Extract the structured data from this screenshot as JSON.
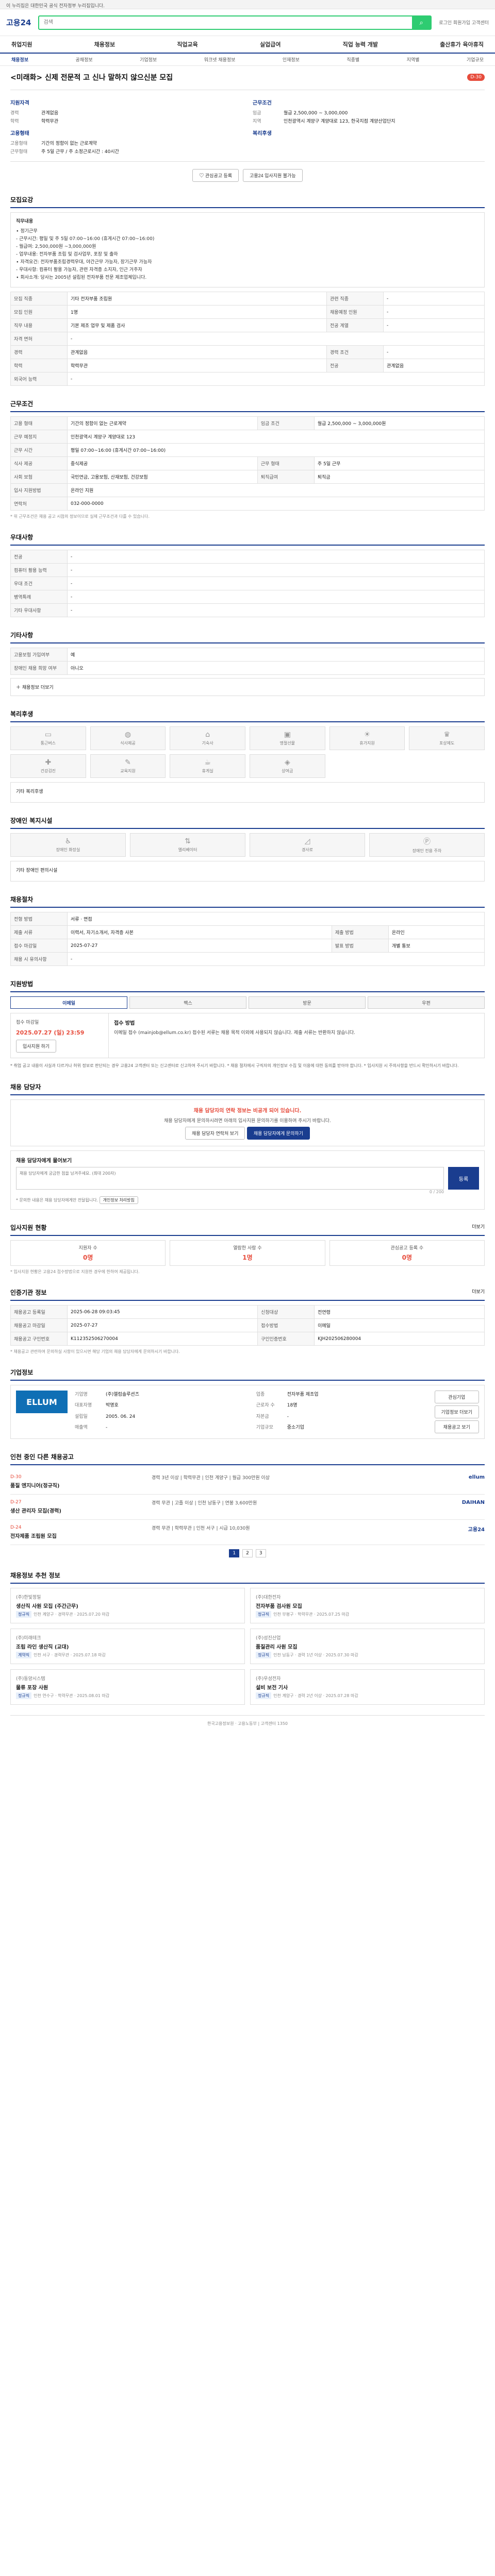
{
  "gov_banner": "이 누리집은 대한민국 공식 전자정부 누리집입니다.",
  "header": {
    "logo": "고용24",
    "search_placeholder": "검색",
    "search_icon": "search-icon",
    "right": "로그인  회원가입  고객센터"
  },
  "gnb": [
    "취업지원",
    "채용정보",
    "직업교육",
    "실업급여",
    "직업 능력 개발",
    "출산휴가 육아휴직"
  ],
  "subnav": {
    "items": [
      "채용정보",
      "공채정보",
      "기업정보",
      "워크넷 채용정보",
      "인재정보",
      "직종별",
      "지역별",
      "기업규모"
    ],
    "active": 0
  },
  "job": {
    "title": "<미래화> 신제 전문적 고 신나 말하지 않으신분 모집",
    "dday": "D-30",
    "left_h": "지원자격",
    "left": [
      [
        "경력",
        "관계없음"
      ],
      [
        "학력",
        "학력무관"
      ]
    ],
    "right_h": "근무조건",
    "right": [
      [
        "임금",
        "월급 2,500,000 ~ 3,000,000"
      ],
      [
        "지역",
        "인천광역시 계양구 계양대로 123, 한국지점 계양산업단지"
      ]
    ],
    "left2_h": "고용형태",
    "left2": [
      [
        "고용형태",
        "기간의 정함이 없는 근로계약"
      ],
      [
        "근무형태",
        "주 5일 근무 / 주 소정근로시간 : 40시간"
      ]
    ],
    "right2_h": "복리후생",
    "right2": [
      [
        "",
        ""
      ]
    ],
    "btn_scrap": "관심공고 등록",
    "btn_apply": "고용24 입사지원 불가능"
  },
  "sections": {
    "recruit": "모집요강",
    "recruit_desc_label": "직무내용",
    "recruit_desc": [
      "∙ 정기근무",
      "- 근무시간: 평일 및 주 5일 07:00~16:00 (휴게시간 07:00~16:00)",
      "- 월급여: 2,500,000원 ~3,000,000원",
      "- 업무내용: 전자부품 조립 및 검사업무, 포장 및 출하",
      "∙ 자격요건: 전자부품조립경력우대, 야간근무 가능자, 장기근무 가능자",
      "- 우대사항: 컴퓨터 활용 가능자, 관련 자격증 소지자, 인근 거주자",
      "∙ 회사소개: 당사는 2005년 설립된 전자부품 전문 제조업체입니다."
    ],
    "recruit_rows": [
      [
        "모집 직종",
        "기타 전자부품 조립원",
        "관련 직종",
        "-"
      ],
      [
        "모집 인원",
        "1명",
        "채용예정 인원",
        "-"
      ],
      [
        "직무 내용",
        "기본 제조 업무 및 제품 검사",
        "전공 계열",
        "-"
      ],
      [
        "자격 면허",
        "-",
        "",
        ""
      ],
      [
        "경력",
        "관계없음",
        "경력 조건",
        "-"
      ],
      [
        "학력",
        "학력무관",
        "전공",
        "관계없음"
      ],
      [
        "외국어 능력",
        "-",
        "",
        ""
      ]
    ],
    "conditions": "근무조건",
    "cond_rows": [
      [
        "고용 형태",
        "기간의 정함이 없는 근로계약",
        "임금 조건",
        "월급 2,500,000 ~ 3,000,000원"
      ],
      [
        "근무 예정지",
        "인천광역시 계양구 계양대로 123",
        "",
        ""
      ],
      [
        "근무 시간",
        "평일 07:00~16:00 (휴게시간 07:00~16:00)",
        "",
        ""
      ],
      [
        "식사 제공",
        "중식제공",
        "근무 형태",
        "주 5일 근무"
      ],
      [
        "사회 보험",
        "국민연금, 고용보험, 산재보험, 건강보험",
        "퇴직급여",
        "퇴직금"
      ],
      [
        "입사 지원방법",
        "온라인 지원",
        "",
        ""
      ],
      [
        "연락처",
        "032-000-0000",
        "",
        ""
      ]
    ],
    "cond_note": "* 위 근무조건은 채용 공고 시점의 정보이므로 실제 근무조건과 다를 수 있습니다.",
    "preference": "우대사항",
    "pref_rows": [
      [
        "전공",
        "-"
      ],
      [
        "컴퓨터 활용 능력",
        "-"
      ],
      [
        "우대 조건",
        "-"
      ],
      [
        "병역특례",
        "-"
      ],
      [
        "기타 우대사항",
        "-"
      ]
    ],
    "others": "기타사항",
    "other_rows": [
      [
        "고용보험 가입여부",
        "예"
      ],
      [
        "장애인 채용 희망 여부",
        "아니오"
      ]
    ],
    "others_fold": "채용정보 더보기",
    "welfare": "복리후생",
    "welfare_items": [
      [
        "car-icon",
        "통근버스"
      ],
      [
        "meal-icon",
        "식사제공"
      ],
      [
        "house-icon",
        "기숙사"
      ],
      [
        "gift-icon",
        "명절선물"
      ],
      [
        "vacation-icon",
        "휴가지원"
      ],
      [
        "trophy-icon",
        "포상제도"
      ],
      [
        "health-icon",
        "건강검진"
      ],
      [
        "edu-icon",
        "교육지원"
      ],
      [
        "coffee-icon",
        "휴게실"
      ],
      [
        "bonus-icon",
        "상여금"
      ]
    ],
    "welfare_more": "기타 복리후생",
    "disabled": "장애인 복지시설",
    "disabled_items": [
      [
        "wheelchair-icon",
        "장애인 화장실"
      ],
      [
        "elevator-icon",
        "엘리베이터"
      ],
      [
        "ramp-icon",
        "경사로"
      ],
      [
        "parking-icon",
        "장애인 전용 주차"
      ]
    ],
    "disabled_more": "기타 장애인 편의시설",
    "process": "채용절차",
    "process_rows": [
      [
        "전형 방법",
        "서류 · 면접"
      ],
      [
        "제출 서류",
        "이력서, 자기소개서, 자격증 사본",
        "제출 방법",
        "온라인"
      ],
      [
        "접수 마감일",
        "2025-07-27",
        "발표 방법",
        "개별 통보"
      ],
      [
        "채용 시 유의사항",
        "-",
        "",
        ""
      ]
    ],
    "apply": "지원방법",
    "apply_tabs": [
      "이메일",
      "팩스",
      "방문",
      "우편"
    ],
    "apply_date_label": "접수 마감일",
    "apply_date": "2025.07.27 (일) 23:59",
    "apply_btn": "입사지원 하기",
    "apply_right_h": "접수 방법",
    "apply_right": "이메일 접수 (mainjob@ellum.co.kr) 접수된 서류는 채용 목적 이외에 사용되지 않습니다. 제출 서류는 반환하지 않습니다.",
    "apply_notice": "* 취업 공고 내용이 사실과 다르거나 허위 정보로 판단되는 경우 고용24 고객센터 또는 신고센터로 신고하여 주시기 바랍니다. * 채용 절차에서 구직자의 개인정보 수집 및 이용에 대한 동의를 받아야 합니다. * 입사지원 시 주의사항을 반드시 확인하시기 바랍니다.",
    "contact": "채용 담당자",
    "contact_warn": "채용 담당자의 연락 정보는 비공개 되어 있습니다.",
    "contact_sub": "채용 담당자에게 문의하시려면 아래의 입사지원 문의하기를 이용하여 주시기 바랍니다.",
    "contact_btn1": "채용 담당자 연락처 보기",
    "contact_btn2": "채용 담당자에게 문의하기",
    "qa_h": "채용 담당자에게 물어보기",
    "qa_placeholder": "채용 담당자에게 궁금한 점을 남겨주세요. (최대 200자)",
    "qa_btn": "등록",
    "qa_count": "0 / 200",
    "qa_note": "* 문의한 내용은 채용 담당자에게만 전달됩니다.",
    "qa_note_btn": "개인정보 처리방침",
    "stats": "입사지원 현황",
    "stats_more": "더보기",
    "stat_items": [
      [
        "지원자 수",
        "0명"
      ],
      [
        "열람한 사람 수",
        "1명"
      ],
      [
        "관심공고 등록 수",
        "0명"
      ]
    ],
    "stats_note": "* 입사지원 현황은 고용24 접수방법으로 지원한 경우에 한하여 제공됩니다.",
    "info": "인증기관 정보",
    "info_more": "더보기",
    "info_rows": [
      [
        "채용공고 등록일",
        "2025-06-28 09:03:45",
        "신청대상",
        "전연령"
      ],
      [
        "채용공고 마감일",
        "2025-07-27",
        "접수방법",
        "이메일"
      ],
      [
        "채용공고 구인번호",
        "K112352506270004",
        "구인인증번호",
        "KJH202506280004"
      ]
    ],
    "info_note": "* 채용공고 관련하여 문의하실 사항이 있으시면 해당 기업의 채용 담당자에게 문의하시기 바랍니다.",
    "company": "기업정보",
    "company_logo": "ELLUM",
    "company_rows": [
      [
        "기업명",
        "(주)엘럼솔루션즈"
      ],
      [
        "업종",
        "전자부품 제조업"
      ],
      [
        "대표자명",
        "박명호"
      ],
      [
        "근로자 수",
        "18명"
      ],
      [
        "설립일",
        "2005. 06. 24"
      ],
      [
        "자본금",
        "-"
      ],
      [
        "매출액",
        "-"
      ],
      [
        "기업규모",
        "중소기업"
      ]
    ],
    "company_btn1": "관심기업",
    "company_btn2": "기업정보 더보기",
    "company_btn3": "채용공고 보기",
    "related": "인천 중인 다른 채용공고",
    "jobs": [
      {
        "dd": "D-30",
        "t": "품질 엔지니어(정규직)",
        "m": "경력 3년 이상 | 학력무관 | 인천 계양구 | 월급 300만원 이상",
        "r": "ellum"
      },
      {
        "dd": "D-27",
        "t": "생산 관리자 모집(경력)",
        "m": "경력 무관 | 고졸 이상 | 인천 남동구 | 연봉 3,600만원",
        "r": "DAIHAN"
      },
      {
        "dd": "D-24",
        "t": "전자제품 조립원 모집",
        "m": "경력 무관 | 학력무관 | 인천 서구 | 시급 10,030원",
        "r": "고용24"
      }
    ],
    "pager": [
      "1",
      "2",
      "3"
    ],
    "rec": "채용정보 추천 정보",
    "rec_items": [
      {
        "co": "(주)한빛정밀",
        "t": "생산직 사원 모집 (주간근무)",
        "b": "정규직",
        "m": "인천 계양구 · 경력무관 · 2025.07.20 마감"
      },
      {
        "co": "(주)대한전자",
        "t": "전자부품 검사원 모집",
        "b": "정규직",
        "m": "인천 부평구 · 학력무관 · 2025.07.25 마감"
      },
      {
        "co": "(주)미래테크",
        "t": "조립 라인 생산직 (교대)",
        "b": "계약직",
        "m": "인천 서구 · 경력무관 · 2025.07.18 마감"
      },
      {
        "co": "(주)성진산업",
        "t": "품질관리 사원 모집",
        "b": "정규직",
        "m": "인천 남동구 · 경력 1년 이상 · 2025.07.30 마감"
      },
      {
        "co": "(주)동양시스템",
        "t": "물류 포장 사원",
        "b": "정규직",
        "m": "인천 연수구 · 학력무관 · 2025.08.01 마감"
      },
      {
        "co": "(주)우성전자",
        "t": "설비 보전 기사",
        "b": "정규직",
        "m": "인천 계양구 · 경력 2년 이상 · 2025.07.28 마감"
      }
    ]
  },
  "footer": "한국고용정보원 · 고용노동부 | 고객센터 1350"
}
